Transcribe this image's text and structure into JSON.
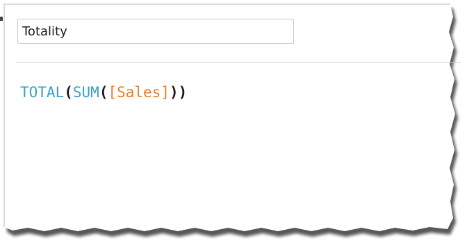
{
  "calc_editor": {
    "name_field": {
      "value": "Totality"
    },
    "formula": {
      "tokens": [
        {
          "text": "TOTAL",
          "kind": "function"
        },
        {
          "text": "(",
          "kind": "paren"
        },
        {
          "text": "SUM",
          "kind": "function"
        },
        {
          "text": "(",
          "kind": "paren"
        },
        {
          "text": "[Sales]",
          "kind": "field"
        },
        {
          "text": ")",
          "kind": "paren"
        },
        {
          "text": ")",
          "kind": "paren"
        }
      ]
    }
  },
  "colors": {
    "function": "#3d9fc4",
    "field": "#e87f24",
    "paren": "#1a1a1a"
  }
}
